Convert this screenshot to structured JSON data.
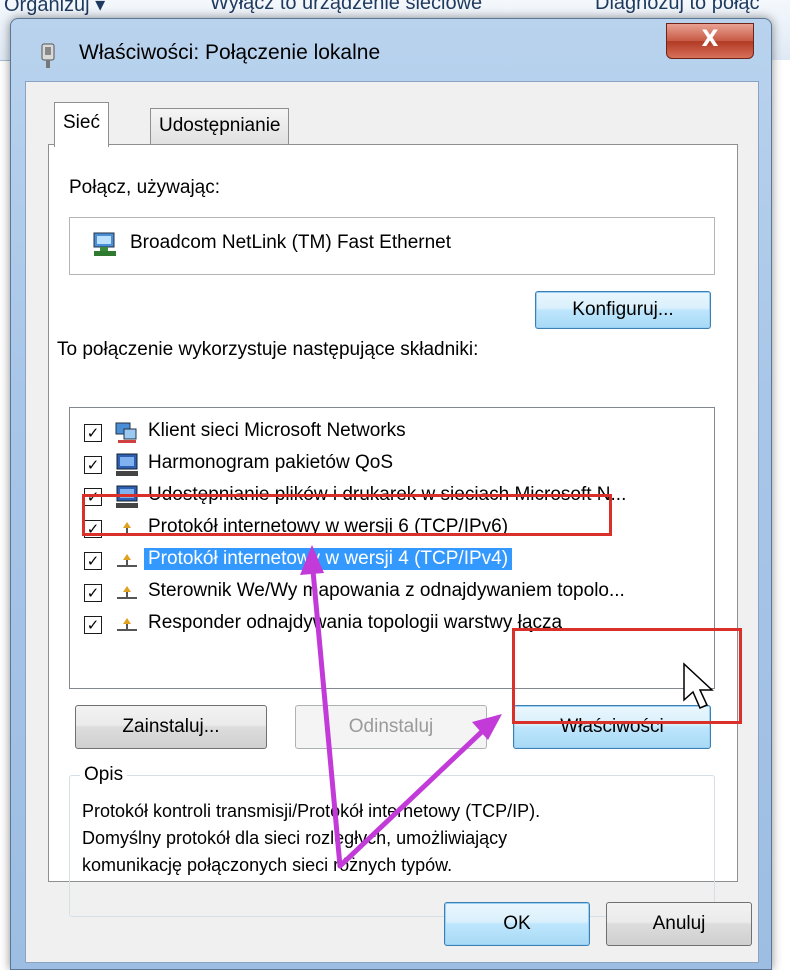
{
  "background": {
    "menu_items": [
      "Organizuj ▾",
      "Wyłącz to urządzenie sieciowe",
      "Diagnozuj to połąc"
    ]
  },
  "dialog": {
    "title": "Właściwości: Połączenie lokalne",
    "close_label": "X",
    "tabs": [
      "Sieć",
      "Udostępnianie"
    ],
    "connect_using_label": "Połącz, używając:",
    "adapter_name": "Broadcom NetLink (TM) Fast Ethernet",
    "configure_button": "Konfiguruj...",
    "components_label": "To połączenie wykorzystuje następujące składniki:",
    "components": [
      {
        "label": "Klient sieci Microsoft Networks",
        "checked": true,
        "icon": "network-client-icon"
      },
      {
        "label": "Harmonogram pakietów QoS",
        "checked": true,
        "icon": "computer-icon"
      },
      {
        "label": "Udostępnianie plików i drukarek w sieciach Microsoft N...",
        "checked": true,
        "icon": "computer-icon"
      },
      {
        "label": "Protokół internetowy w wersji 6 (TCP/IPv6)",
        "checked": true,
        "icon": "protocol-icon"
      },
      {
        "label": "Protokół internetowy w wersji 4 (TCP/IPv4)",
        "checked": true,
        "icon": "protocol-icon",
        "selected": true
      },
      {
        "label": "Sterownik We/Wy mapowania z odnajdywaniem topolo...",
        "checked": true,
        "icon": "protocol-icon"
      },
      {
        "label": "Responder odnajdywania topologii warstwy łącza",
        "checked": true,
        "icon": "protocol-icon"
      }
    ],
    "install_button": "Zainstaluj...",
    "uninstall_button": "Odinstaluj",
    "properties_button": "Właściwości",
    "description_legend": "Opis",
    "description_lines": [
      "Protokół kontroli transmisji/Protokół internetowy (TCP/IP).",
      "Domyślny protokół dla sieci rozległych, umożliwiający",
      "komunikację połączonych sieci różnych typów."
    ],
    "ok_button": "OK",
    "cancel_button": "Anuluj"
  },
  "colors": {
    "selection": "#3399ff",
    "annotation_box": "#d9312a",
    "annotation_arrow": "#c23bd9"
  }
}
